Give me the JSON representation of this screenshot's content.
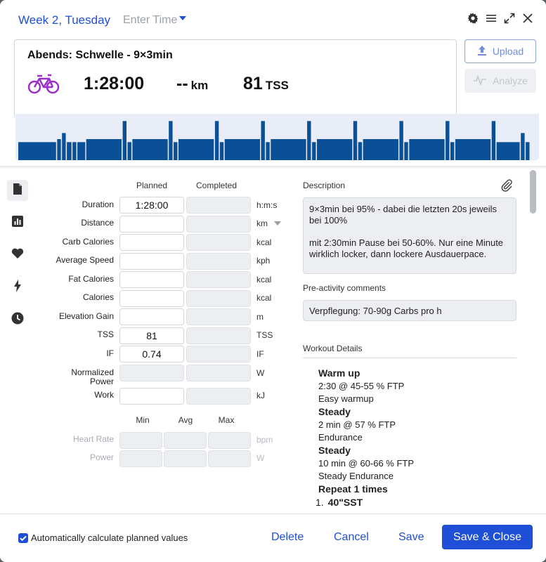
{
  "header": {
    "date": "Week 2, Tuesday",
    "time_placeholder": "Enter Time"
  },
  "workout": {
    "title": "Abends: Schwelle - 9×3min",
    "sport_icon": "bike-icon",
    "duration": "1:28:00",
    "distance": "--",
    "distance_unit": "km",
    "tss": "81",
    "tss_unit": "TSS"
  },
  "actions": {
    "upload": "Upload",
    "analyze": "Analyze"
  },
  "profile_bars": [
    [
      0.3,
      0.48
    ],
    [
      0.35,
      0.06
    ],
    [
      0.45,
      0.06
    ],
    [
      0.3,
      0.07
    ],
    [
      0.3,
      0.06
    ],
    [
      0.3,
      0.11
    ],
    [
      0.35,
      0.45
    ],
    [
      0.65,
      0.06
    ],
    [
      0.3,
      0.06
    ],
    [
      0.35,
      0.45
    ],
    [
      0.65,
      0.06
    ],
    [
      0.3,
      0.06
    ],
    [
      0.35,
      0.45
    ],
    [
      0.65,
      0.06
    ],
    [
      0.3,
      0.06
    ],
    [
      0.35,
      0.45
    ],
    [
      0.65,
      0.06
    ],
    [
      0.3,
      0.06
    ],
    [
      0.35,
      0.45
    ],
    [
      0.65,
      0.06
    ],
    [
      0.3,
      0.06
    ],
    [
      0.35,
      0.45
    ],
    [
      0.65,
      0.06
    ],
    [
      0.3,
      0.06
    ],
    [
      0.35,
      0.45
    ],
    [
      0.65,
      0.06
    ],
    [
      0.3,
      0.06
    ],
    [
      0.35,
      0.45
    ],
    [
      0.65,
      0.06
    ],
    [
      0.3,
      0.06
    ],
    [
      0.35,
      0.45
    ],
    [
      0.65,
      0.06
    ],
    [
      0.3,
      0.3
    ],
    [
      0.45,
      0.06
    ],
    [
      0.3,
      0.06
    ]
  ],
  "metrics": {
    "col_planned": "Planned",
    "col_completed": "Completed",
    "rows": [
      {
        "label": "Duration",
        "planned": "1:28:00",
        "unit": "h:m:s"
      },
      {
        "label": "Distance",
        "planned": "",
        "unit": "km"
      },
      {
        "label": "Carb Calories",
        "planned": "",
        "unit": "kcal"
      },
      {
        "label": "Average Speed",
        "planned": "",
        "unit": "kph"
      },
      {
        "label": "Fat Calories",
        "planned": "",
        "unit": "kcal"
      },
      {
        "label": "Calories",
        "planned": "",
        "unit": "kcal"
      },
      {
        "label": "Elevation Gain",
        "planned": "",
        "unit": "m"
      },
      {
        "label": "TSS",
        "planned": "81",
        "unit": "TSS"
      },
      {
        "label": "IF",
        "planned": "0.74",
        "unit": "IF"
      },
      {
        "label": "Normalized Power",
        "planned": "",
        "unit": "W"
      },
      {
        "label": "Work",
        "planned": "",
        "unit": "kJ"
      }
    ],
    "range_cols": [
      "Min",
      "Avg",
      "Max"
    ],
    "range_rows": [
      {
        "label": "Heart Rate",
        "unit": "bpm"
      },
      {
        "label": "Power",
        "unit": "W"
      }
    ]
  },
  "description": {
    "title": "Description",
    "text1": "9×3min bei 95% - dabei die letzten 20s jeweils bei 100%",
    "text2": "mit 2:30min Pause bei 50-60%. Nur eine Minute wirklich locker, dann lockere Ausdauerpace."
  },
  "comments": {
    "title": "Pre-activity comments",
    "text": "Verpflegung: 70-90g Carbs pro h"
  },
  "workout_details": {
    "title": "Workout Details",
    "steps": [
      {
        "name": "Warm up",
        "line": "2:30 @ 45-55 % FTP",
        "note": "Easy warmup"
      },
      {
        "name": "Steady",
        "line": "2 min @ 57 % FTP",
        "note": "Endurance"
      },
      {
        "name": "Steady",
        "line": "10 min @ 60-66 % FTP",
        "note": "Steady Endurance"
      }
    ],
    "repeat": "Repeat 1 times",
    "item_num": "1.",
    "item_name": "40\"SST"
  },
  "footer": {
    "auto_calc": "Automatically calculate planned values",
    "delete": "Delete",
    "cancel": "Cancel",
    "save": "Save",
    "save_close": "Save & Close"
  },
  "colors": {
    "accent": "#1e4fd6",
    "bike": "#9b30c9",
    "bar": "#0b4f96"
  }
}
